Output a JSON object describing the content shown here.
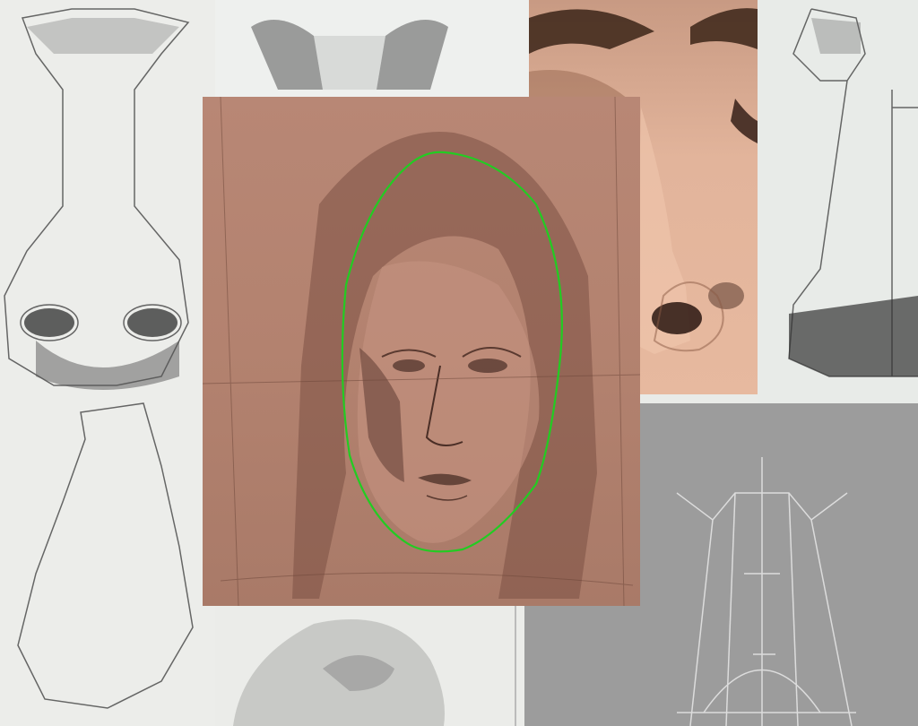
{
  "canvas": {
    "background": "#e9ebe8"
  },
  "panels": [
    {
      "id": "left-nose-sketch",
      "icon": "pencil-sketch-icon",
      "tone": "#ededea"
    },
    {
      "id": "top-nose-sketch",
      "icon": "pencil-sketch-icon",
      "tone": "#eef0ee"
    },
    {
      "id": "nose-photo",
      "icon": "photo-icon",
      "tone": "#d8a98f"
    },
    {
      "id": "right-nose-sketch",
      "icon": "pencil-sketch-icon",
      "tone": "#e8ebe8"
    },
    {
      "id": "gray-construction",
      "icon": "construction-lines-icon",
      "tone": "#9c9c9c"
    },
    {
      "id": "bottom-nose-sketch",
      "icon": "pencil-sketch-icon",
      "tone": "#ebece9"
    },
    {
      "id": "portrait-sketch",
      "icon": "portrait-sketch-icon",
      "tone": "#b58472"
    }
  ],
  "overlay": {
    "face_oval_color": "#22cc22"
  }
}
